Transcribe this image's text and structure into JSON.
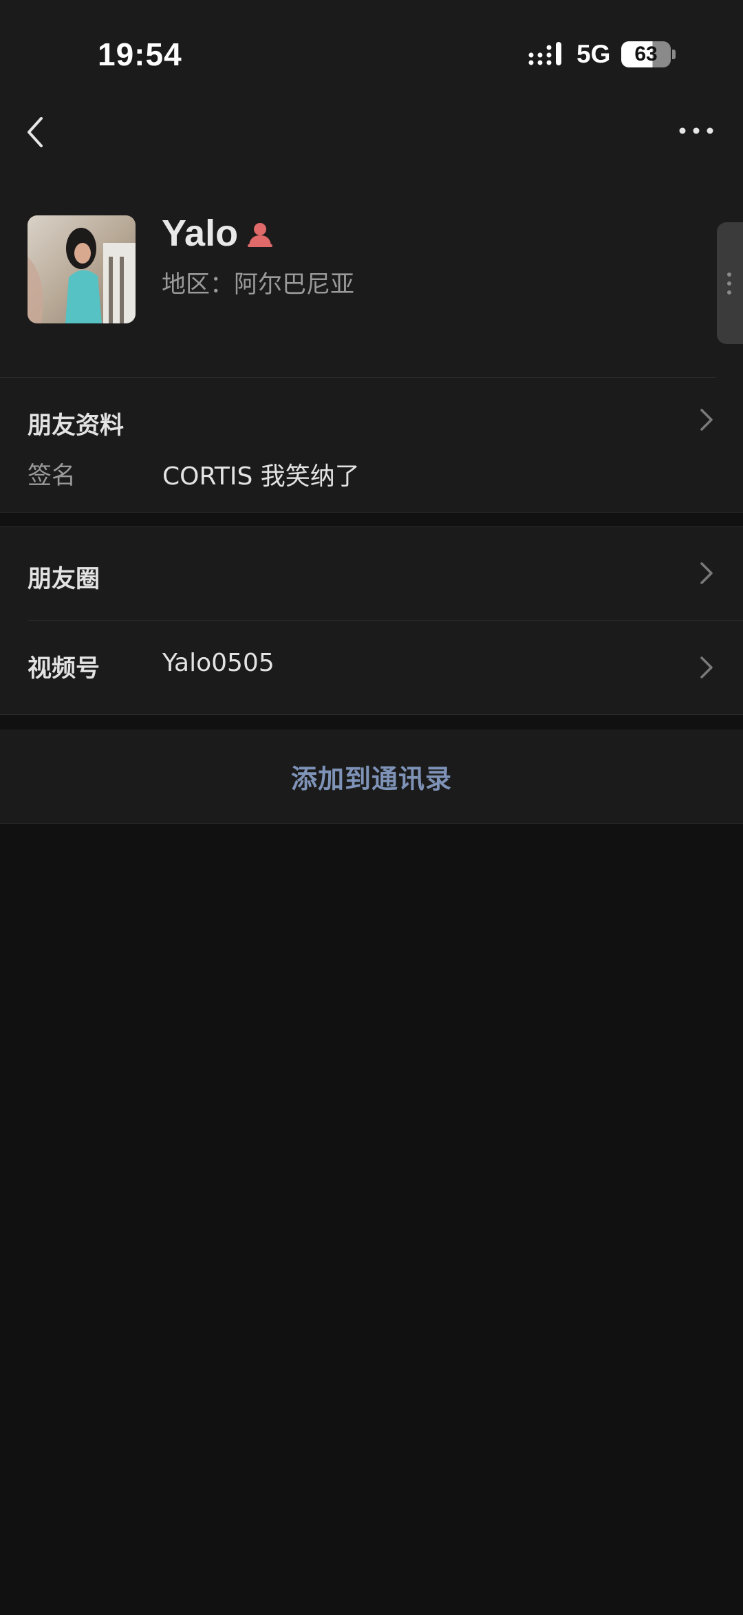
{
  "status_bar": {
    "time": "19:54",
    "network": "5G",
    "battery": "63"
  },
  "nav": {
    "back_icon": "chevron-left-icon",
    "more_icon": "more-dots-icon"
  },
  "profile": {
    "name": "Yalo",
    "gender_icon": "female-icon",
    "gender_color": "#e06a6a",
    "region": "地区：阿尔巴尼亚"
  },
  "friend_info": {
    "title": "朋友资料",
    "signature_label": "签名",
    "signature_value": "CORTIS 我笑纳了"
  },
  "moments": {
    "title": "朋友圈"
  },
  "channels": {
    "label": "视频号",
    "value": "Yalo0505"
  },
  "actions": {
    "add_contact": "添加到通讯录",
    "add_contact_color": "#7e93b7"
  }
}
